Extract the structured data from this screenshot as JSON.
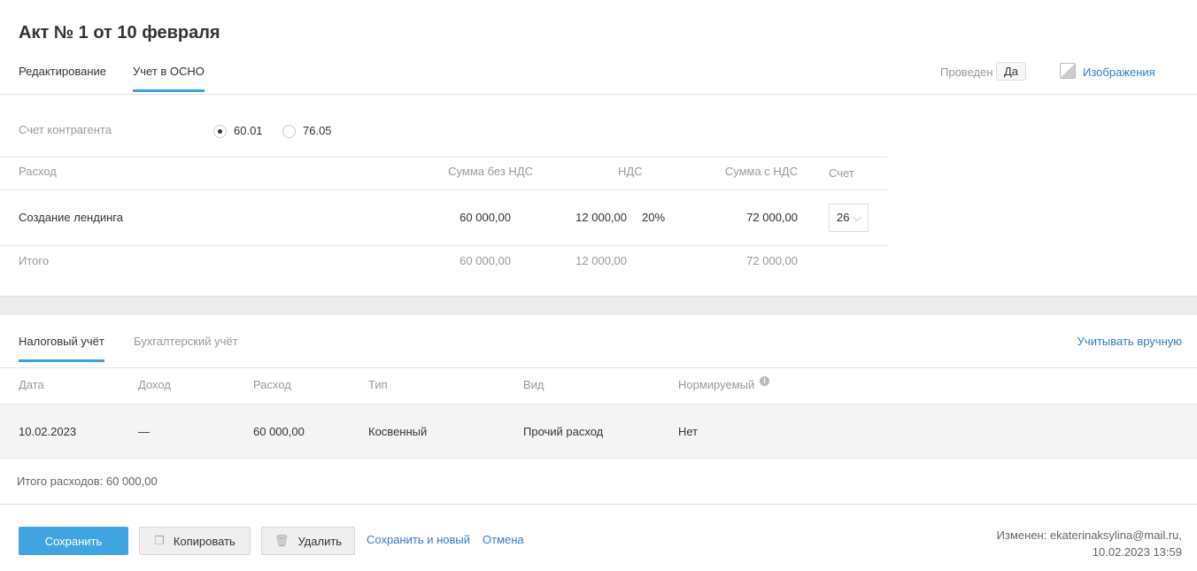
{
  "title": "Акт № 1 от 10 февраля",
  "tabs": [
    "Редактирование",
    "Учет в ОСНО"
  ],
  "posted_label": "Проведен",
  "posted_value": "Да",
  "images_link": "Изображения",
  "counterparty": {
    "label": "Счет контрагента",
    "options": [
      "60.01",
      "76.05"
    ],
    "selected": "60.01"
  },
  "table": {
    "headers": [
      "Расход",
      "Сумма без НДС",
      "НДС",
      "Сумма с НДС",
      "Счет"
    ],
    "row": {
      "name": "Создание лендинга",
      "net": "60 000,00",
      "vat": "12 000,00",
      "rate": "20%",
      "gross": "72 000,00",
      "account": "26"
    },
    "total": {
      "label": "Итого",
      "net": "60 000,00",
      "vat": "12 000,00",
      "gross": "72 000,00"
    }
  },
  "tax": {
    "tabs": [
      "Налоговый учёт",
      "Бухгалтерский учёт"
    ],
    "manual_link": "Учитывать вручную",
    "headers": [
      "Дата",
      "Доход",
      "Расход",
      "Тип",
      "Вид",
      "Нормируемый"
    ],
    "row": [
      "10.02.2023",
      "—",
      "60 000,00",
      "Косвенный",
      "Прочий расход",
      "Нет"
    ],
    "total": "Итого расходов: 60 000,00"
  },
  "footer": {
    "save": "Сохранить",
    "copy": "Копировать",
    "delete": "Удалить",
    "save_new": "Сохранить и новый",
    "cancel": "Отмена",
    "modified": "Изменен: ekaterinaksylina@mail.ru,",
    "modified_date": "10.02.2023 13:59"
  }
}
